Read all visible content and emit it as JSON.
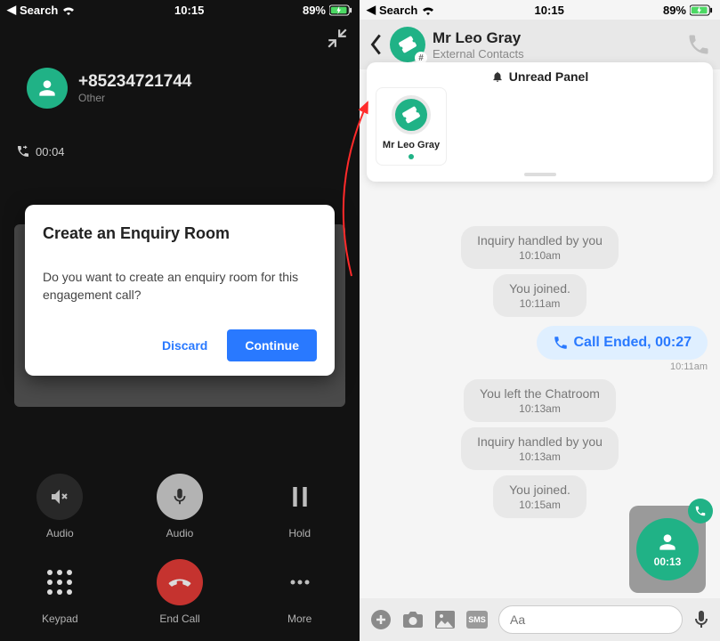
{
  "status": {
    "back_label": "Search",
    "time": "10:15",
    "battery": "89%"
  },
  "left": {
    "caller_number": "+85234721744",
    "caller_sub": "Other",
    "call_timer": "00:04",
    "dialog": {
      "title": "Create an Enquiry Room",
      "body": "Do you want to create an enquiry room for this engagement call?",
      "discard": "Discard",
      "continue": "Continue"
    },
    "controls": {
      "audio_out": "Audio",
      "mute": "Audio",
      "hold": "Hold",
      "keypad": "Keypad",
      "end": "End Call",
      "more": "More"
    }
  },
  "right": {
    "contact_name": "Mr Leo Gray",
    "contact_sub": "External Contacts",
    "unread_panel_label": "Unread Panel",
    "unread_card_name": "Mr Leo Gray",
    "messages": [
      {
        "text": "Inquiry handled by you",
        "ts": "10:10am"
      },
      {
        "text": "You joined.",
        "ts": "10:11am"
      }
    ],
    "call_ended": {
      "text": "Call Ended, 00:27",
      "ts": "10:11am"
    },
    "messages2": [
      {
        "text": "You left the Chatroom",
        "ts": "10:13am"
      },
      {
        "text": "Inquiry handled by you",
        "ts": "10:13am"
      },
      {
        "text": "You joined.",
        "ts": "10:15am"
      }
    ],
    "float_timer": "00:13",
    "input_placeholder": "Aa",
    "sms_label": "SMS"
  }
}
